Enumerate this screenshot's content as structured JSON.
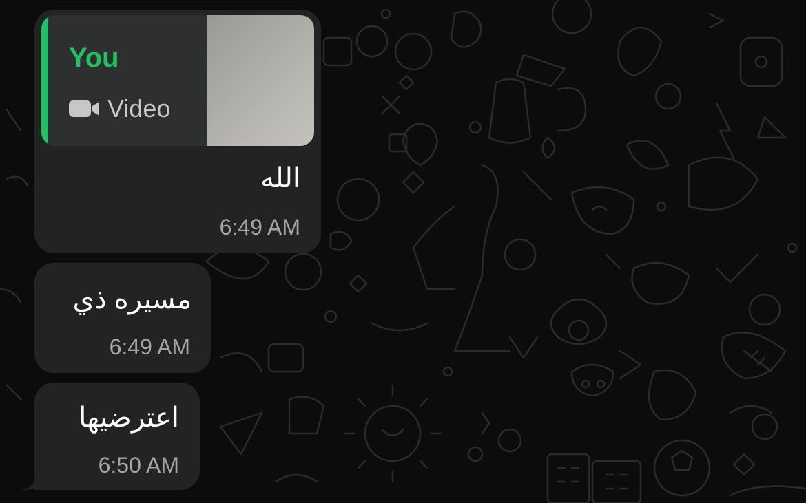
{
  "colors": {
    "background": "#0c0c0c",
    "bubble_incoming": "#222423",
    "quote_background": "#2e302f",
    "accent_green": "#21c063",
    "timestamp": "#a4a6a5",
    "message_text": "#ffffff"
  },
  "messages": [
    {
      "quoted": {
        "sender": "You",
        "type_icon": "video-camera-icon",
        "type_label": "Video"
      },
      "text": "الله",
      "time": "6:49 AM"
    },
    {
      "text": "مسيره ذي",
      "time": "6:49 AM"
    },
    {
      "text": "اعترضيها",
      "time": "6:50 AM"
    }
  ]
}
